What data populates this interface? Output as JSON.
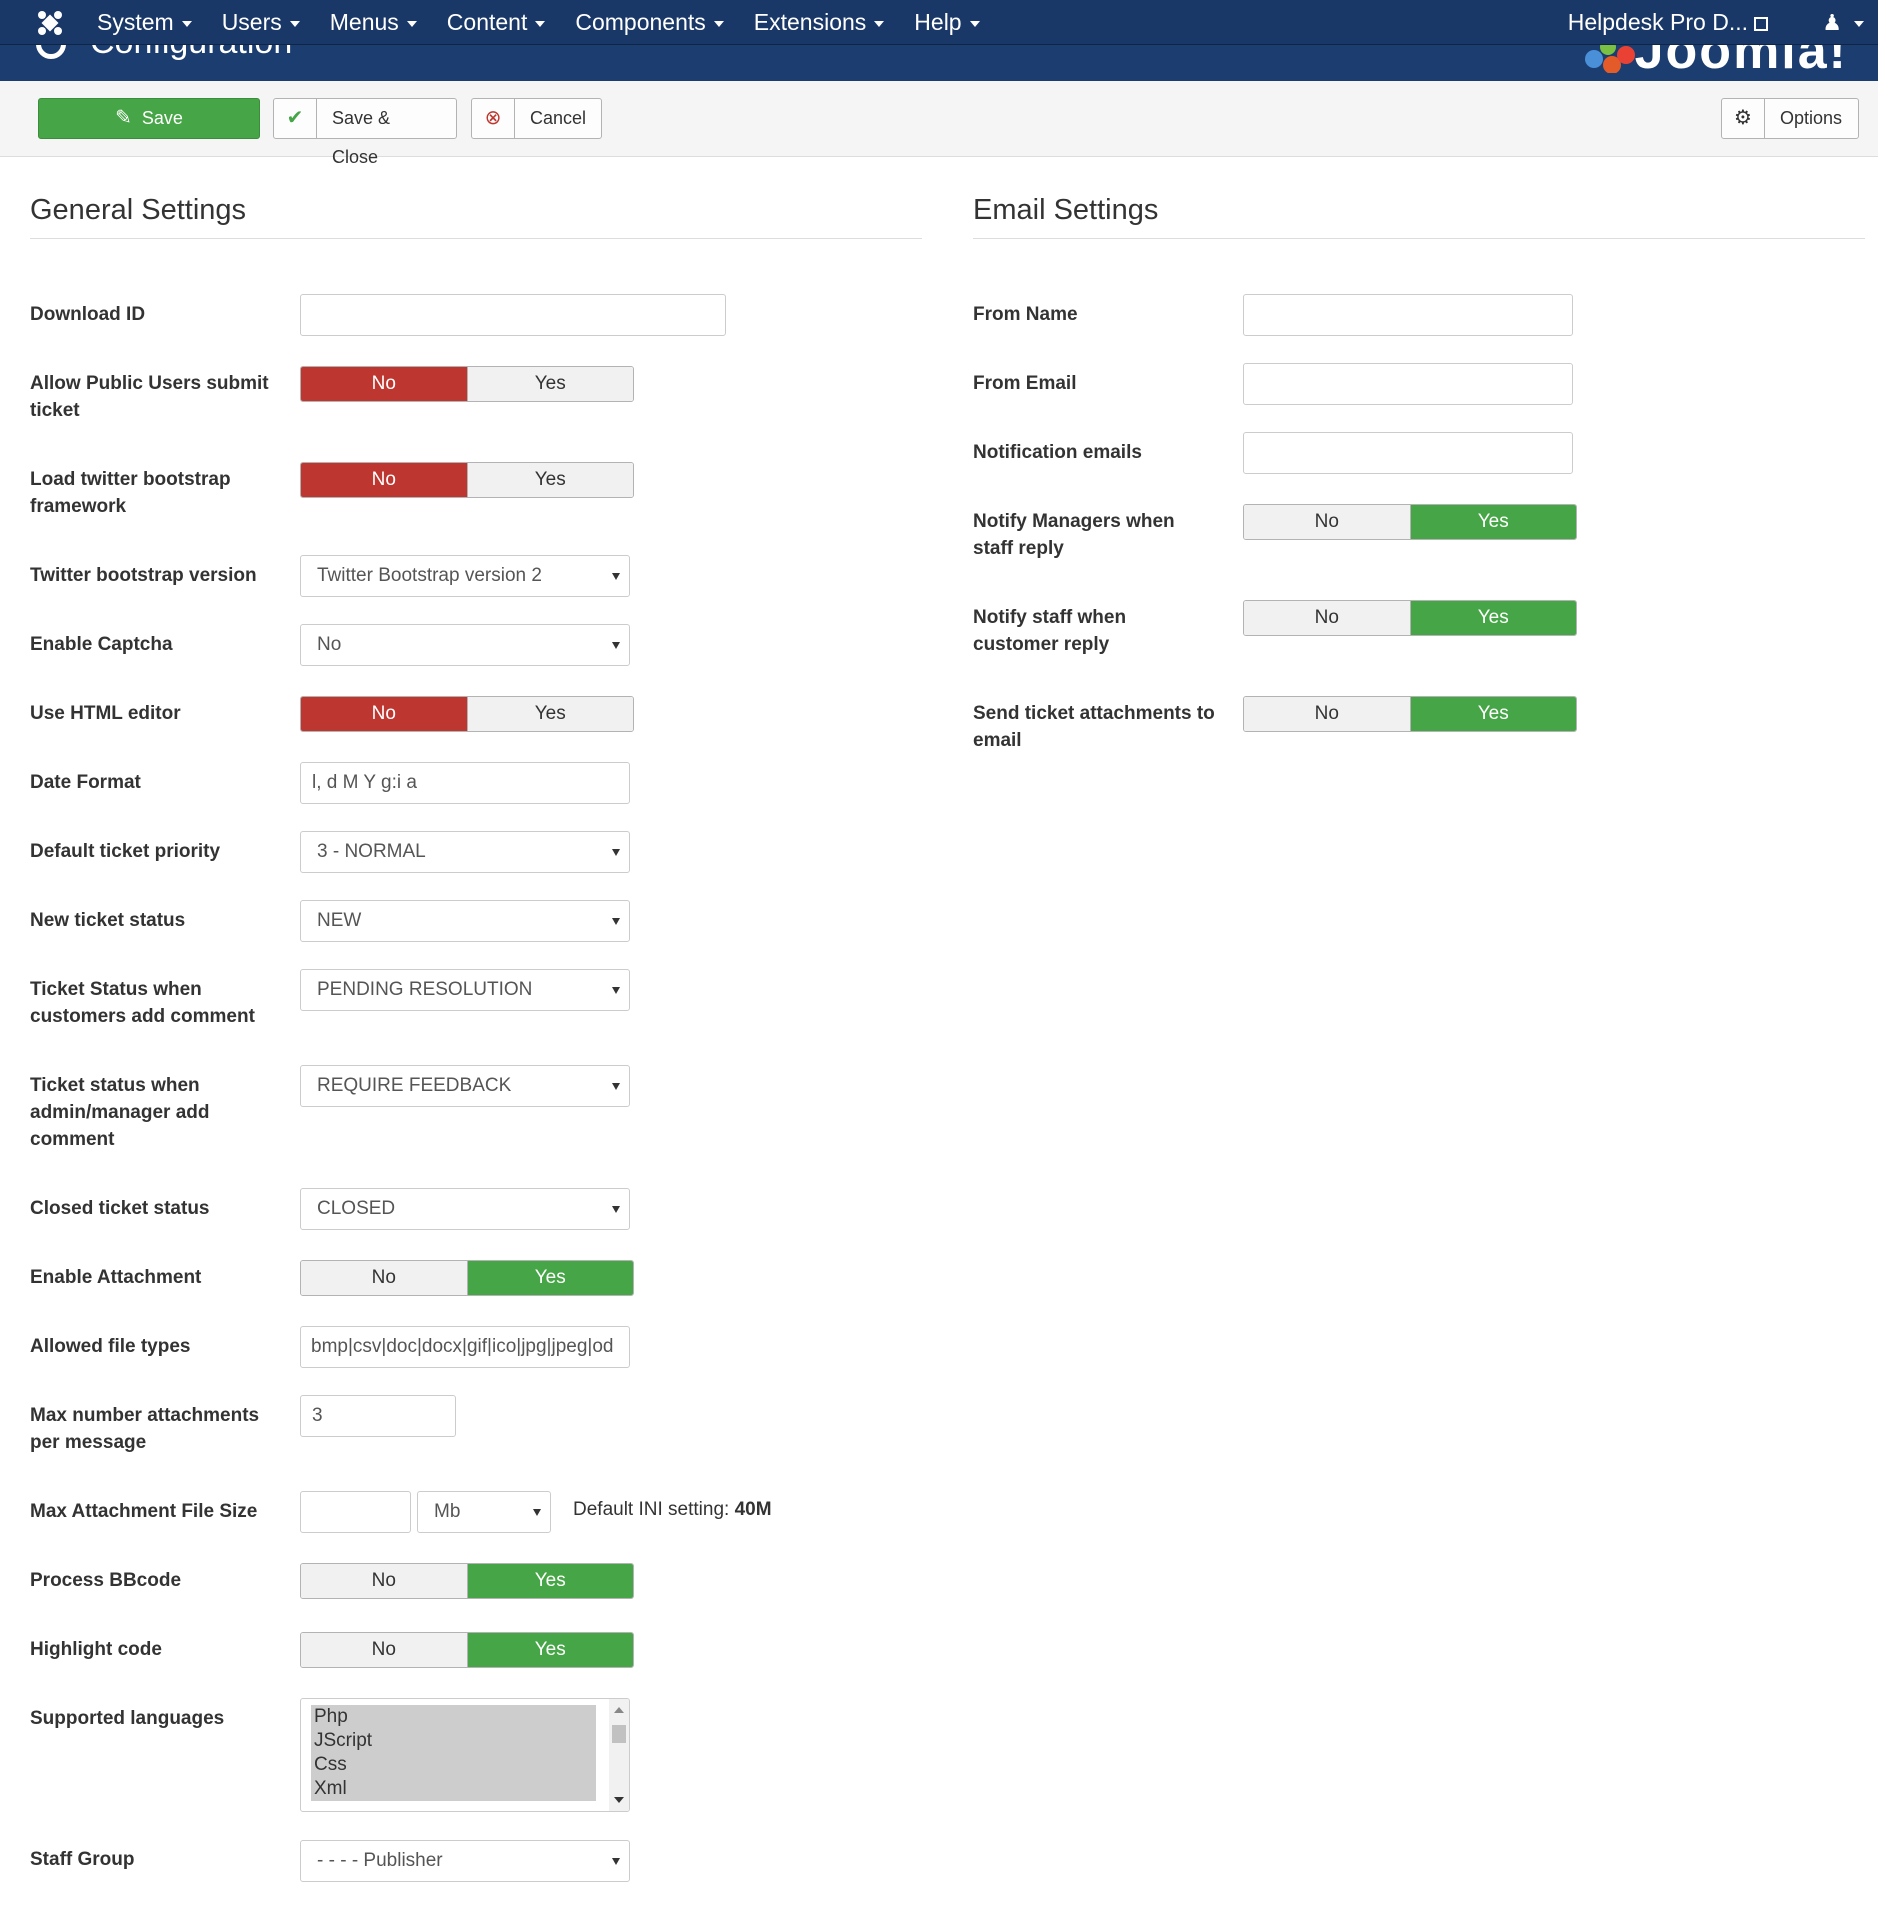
{
  "topnav": {
    "menu": [
      "System",
      "Users",
      "Menus",
      "Content",
      "Components",
      "Extensions",
      "Help"
    ],
    "site_link": "Helpdesk Pro D..."
  },
  "header": {
    "title": "Configuration",
    "brand": "Joomla!"
  },
  "toolbar": {
    "save_label": "Save",
    "save_close_label": "Save & Close",
    "cancel_label": "Cancel",
    "options_label": "Options"
  },
  "general": {
    "title": "General Settings",
    "download_id": {
      "label": "Download ID",
      "value": ""
    },
    "allow_public": {
      "label": "Allow Public Users submit ticket",
      "no": "No",
      "yes": "Yes",
      "selected": "No"
    },
    "load_bootstrap": {
      "label": "Load twitter bootstrap framework",
      "no": "No",
      "yes": "Yes",
      "selected": "No"
    },
    "bootstrap_version": {
      "label": "Twitter bootstrap version",
      "value": "Twitter Bootstrap version 2"
    },
    "captcha": {
      "label": "Enable Captcha",
      "value": "No"
    },
    "html_editor": {
      "label": "Use HTML editor",
      "no": "No",
      "yes": "Yes",
      "selected": "No"
    },
    "date_format": {
      "label": "Date Format",
      "value": "l, d M Y g:i a"
    },
    "priority": {
      "label": "Default ticket priority",
      "value": "3 - NORMAL"
    },
    "new_status": {
      "label": "New ticket status",
      "value": "NEW"
    },
    "customer_comment_status": {
      "label": "Ticket Status when customers add comment",
      "value": "PENDING RESOLUTION"
    },
    "admin_comment_status": {
      "label": "Ticket status when admin/manager add comment",
      "value": "REQUIRE FEEDBACK"
    },
    "closed_status": {
      "label": "Closed ticket status",
      "value": "CLOSED"
    },
    "attachment": {
      "label": "Enable Attachment",
      "no": "No",
      "yes": "Yes",
      "selected": "Yes"
    },
    "file_types": {
      "label": "Allowed file types",
      "value": "bmp|csv|doc|docx|gif|ico|jpg|jpeg|od"
    },
    "max_attachments": {
      "label": "Max number attachments per message",
      "value": "3"
    },
    "max_size": {
      "label": "Max Attachment File Size",
      "value": "",
      "unit": "Mb",
      "note_prefix": "Default INI setting:",
      "note_value": "40M"
    },
    "bbcode": {
      "label": "Process BBcode",
      "no": "No",
      "yes": "Yes",
      "selected": "Yes"
    },
    "highlight": {
      "label": "Highlight code",
      "no": "No",
      "yes": "Yes",
      "selected": "Yes"
    },
    "languages": {
      "label": "Supported languages",
      "items": [
        "Php",
        "JScript",
        "Css",
        "Xml"
      ]
    },
    "staff_group": {
      "label": "Staff Group",
      "value": "- - - - Publisher"
    }
  },
  "email": {
    "title": "Email Settings",
    "from_name": {
      "label": "From Name",
      "value": ""
    },
    "from_email": {
      "label": "From Email",
      "value": ""
    },
    "notification_emails": {
      "label": "Notification emails",
      "value": ""
    },
    "notify_managers": {
      "label": "Notify Managers when staff reply",
      "no": "No",
      "yes": "Yes",
      "selected": "Yes"
    },
    "notify_staff": {
      "label": "Notify staff when customer reply",
      "no": "No",
      "yes": "Yes",
      "selected": "Yes"
    },
    "send_attachments": {
      "label": "Send ticket attachments to email",
      "no": "No",
      "yes": "Yes",
      "selected": "Yes"
    }
  },
  "colors": {
    "nav": "#1a3867",
    "success": "#46a546",
    "danger": "#bd362f"
  },
  "icons": {
    "logo": "joomla-logo-icon",
    "save": "edit-icon",
    "save_close": "check-icon",
    "cancel": "cancel-circle-icon",
    "options": "gear-icon",
    "user": "user-icon",
    "external": "external-link-icon"
  }
}
